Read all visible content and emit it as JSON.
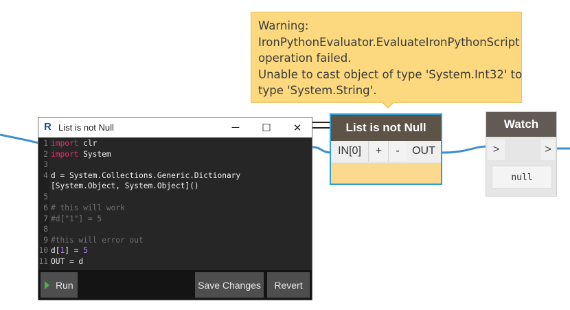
{
  "warning": {
    "lines": [
      "Warning:",
      "IronPythonEvaluator.EvaluateIronPythonScript",
      "operation failed.",
      "Unable to cast object of type 'System.Int32' to",
      "type 'System.String'."
    ]
  },
  "python_node": {
    "title": "List is not Null",
    "input_port": "IN[0]",
    "add_port": "+",
    "remove_port": "-",
    "output_port": "OUT"
  },
  "watch_node": {
    "title": "Watch",
    "input_port": ">",
    "output_port": ">",
    "value": "null"
  },
  "editor": {
    "app_icon": "R",
    "title": "List is not Null",
    "minimize": "─",
    "maximize": "☐",
    "close": "✕",
    "code": {
      "l1_num": "1",
      "l1_kw": "import",
      "l1_rest": " clr",
      "l2_num": "2",
      "l2_kw": "import",
      "l2_rest": " System",
      "l3_num": "3",
      "l4_num": "4",
      "l4_text": "d = System.Collections.Generic.Dictionary",
      "l4b_text": "[System.Object, System.Object]()",
      "l5_num": "5",
      "l6_num": "6",
      "l6_text": "# this will work",
      "l7_num": "7",
      "l7_text": "#d[\"1\"] = 5",
      "l8_num": "8",
      "l9_num": "9",
      "l9_text": "#this will error out",
      "l10_num": "10",
      "l10_a": "d[",
      "l10_num_val": "1",
      "l10_b": "] = ",
      "l10_val": "5",
      "l11_num": "11",
      "l11_text": "OUT = d"
    },
    "run_label": "Run",
    "save_label": "Save Changes",
    "revert_label": "Revert"
  },
  "colors": {
    "wire": "#3b8fd4",
    "node_header": "#5d5347",
    "warning_bg": "#fcd97e"
  }
}
